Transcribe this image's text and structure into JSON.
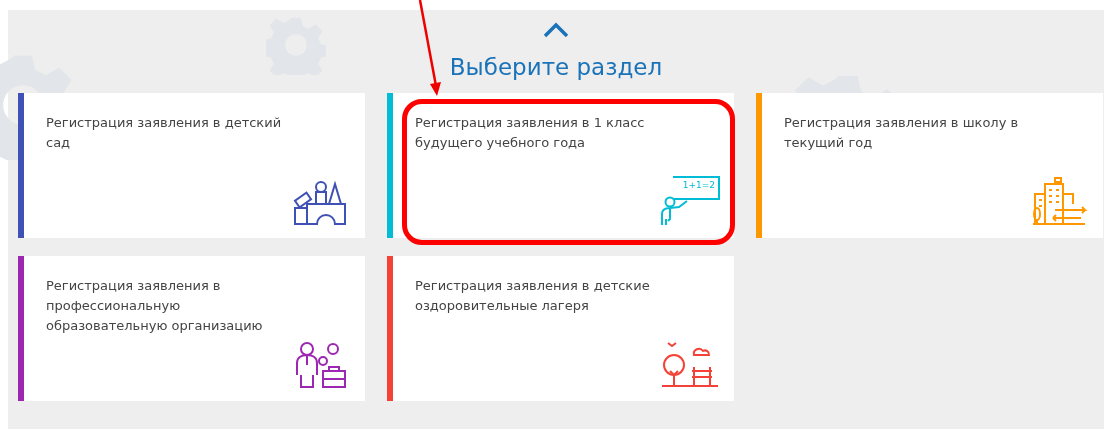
{
  "heading": "Выберите раздел",
  "cards": [
    {
      "label": "Регистрация заявления в детский сад",
      "color": "#3f51b5",
      "kind": "blocks",
      "highlighted": false
    },
    {
      "label": "Регистрация заявления в 1 класс будущего учебного года",
      "color": "#00bcd4",
      "kind": "teacher",
      "icon_text": "1+1=2",
      "highlighted": true
    },
    {
      "label": "Регистрация заявления в школу в текущий год",
      "color": "#ff9800",
      "kind": "buildings",
      "highlighted": false
    },
    {
      "label": "Регистрация заявления в профессиональную образовательную организацию",
      "color": "#9c27b0",
      "kind": "worker",
      "highlighted": false
    },
    {
      "label": "Регистрация заявления в детские оздоровительные лагеря",
      "color": "#f44336",
      "kind": "park",
      "highlighted": false
    }
  ]
}
